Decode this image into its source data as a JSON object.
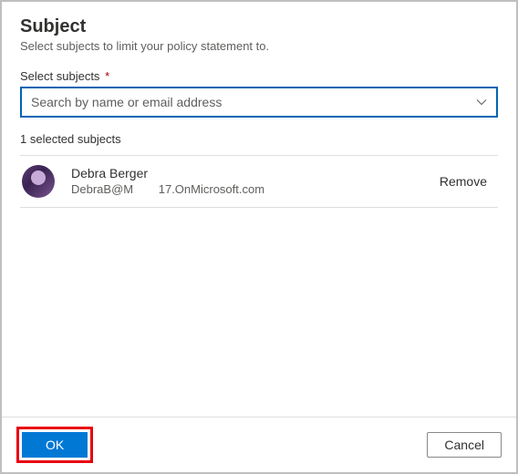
{
  "header": {
    "title": "Subject",
    "subtitle": "Select subjects to limit your policy statement to."
  },
  "field": {
    "label": "Select subjects",
    "required_marker": "*",
    "placeholder": "Search by name or email address"
  },
  "selected": {
    "count_text": "1 selected subjects",
    "items": [
      {
        "name": "Debra Berger",
        "email_part1": "DebraB@M",
        "email_part2": "17.OnMicrosoft.com",
        "remove_label": "Remove"
      }
    ]
  },
  "footer": {
    "ok_label": "OK",
    "cancel_label": "Cancel"
  }
}
